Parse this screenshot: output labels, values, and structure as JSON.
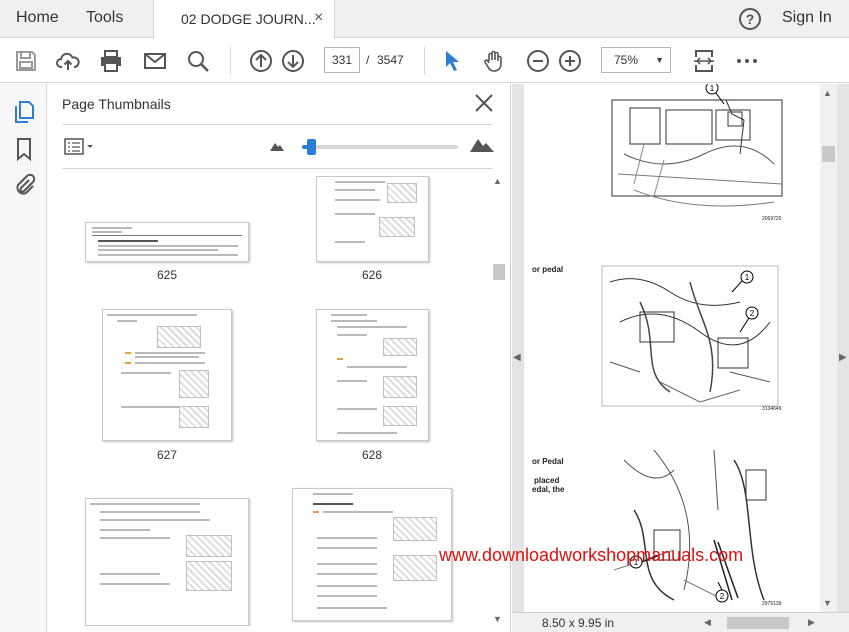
{
  "menubar": {
    "home_label": "Home",
    "tools_label": "Tools",
    "tab_title": "02 DODGE JOURN...",
    "tab_close": "×",
    "help_glyph": "?",
    "signin_label": "Sign In"
  },
  "toolbar": {
    "icons": [
      "save-icon",
      "upload-cloud-icon",
      "print-icon",
      "email-icon",
      "search-icon",
      "page-up-icon",
      "page-down-icon",
      "select-cursor-icon",
      "hand-tool-icon",
      "zoom-out-icon",
      "zoom-in-icon",
      "fit-page-icon",
      "more-icon"
    ],
    "current_page": "331",
    "page_separator": "/",
    "total_pages": "3547",
    "zoom": "75%"
  },
  "rail": {
    "icons": [
      "page-thumbnails-icon",
      "bookmark-icon",
      "attachment-icon"
    ],
    "active_color": "#2a7fd4"
  },
  "thumbnails_panel": {
    "title": "Page Thumbnails",
    "slider_value_fraction": 0.06,
    "thumbnails": [
      {
        "label": "625"
      },
      {
        "label": "626"
      },
      {
        "label": "627"
      },
      {
        "label": "628"
      },
      {
        "label": ""
      },
      {
        "label": ""
      }
    ]
  },
  "document": {
    "page_size": "8.50 x 9.95 in",
    "snippets": {
      "snippet_a": "or pedal",
      "snippet_b": "or Pedal",
      "snippet_c": "placed",
      "snippet_d": "edal, the"
    },
    "figure_codes": [
      "2069720",
      "3134649",
      "2975139"
    ],
    "callouts": [
      "1",
      "1",
      "2",
      "1",
      "2"
    ]
  },
  "watermark": "www.downloadworkshopmanuals.com",
  "colors": {
    "accent": "#2a7fd4",
    "watermark": "#e01010",
    "toolbar_bg": "#ffffff",
    "menubar_bg": "#f0f0f0"
  }
}
